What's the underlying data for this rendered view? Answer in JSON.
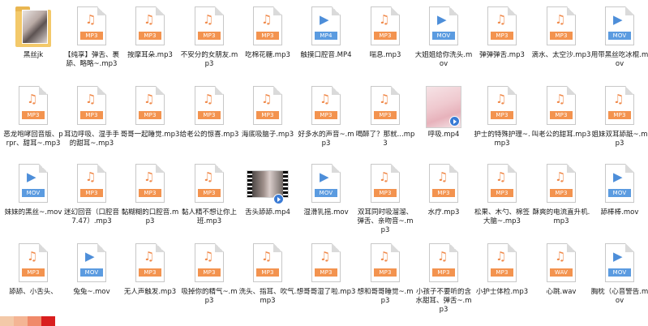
{
  "files": [
    {
      "name": "黑丝jk",
      "type": "folder",
      "icon": "folder-icon"
    },
    {
      "name": "【纯享】弹舌、裹舔、略略~.mp3",
      "type": "mp3",
      "badge": "MP3",
      "icon": "music-note-icon"
    },
    {
      "name": "按摩耳朵.mp3",
      "type": "mp3",
      "badge": "MP3",
      "icon": "music-note-icon"
    },
    {
      "name": "不安分的女朋友.mp3",
      "type": "mp3",
      "badge": "MP3",
      "icon": "music-note-icon"
    },
    {
      "name": "吃棉花糖.mp3",
      "type": "mp3",
      "badge": "MP3",
      "icon": "music-note-icon"
    },
    {
      "name": "触摸口腔音.MP4",
      "type": "mp4",
      "badge": "MP4",
      "icon": "video-camera-icon"
    },
    {
      "name": "喘息.mp3",
      "type": "mp3",
      "badge": "MP3",
      "icon": "music-note-icon"
    },
    {
      "name": "大姐姐给你洗头.mov",
      "type": "mov",
      "badge": "MOV",
      "icon": "video-camera-icon"
    },
    {
      "name": "弹弹弹舌.mp3",
      "type": "mp3",
      "badge": "MP3",
      "icon": "music-note-icon"
    },
    {
      "name": "滴水、太空沙.mp3",
      "type": "mp3",
      "badge": "MP3",
      "icon": "music-note-icon"
    },
    {
      "name": "用带黑丝吃冰棍.mov",
      "type": "mov",
      "badge": "MOV",
      "icon": "video-camera-icon"
    },
    {
      "name": "恶龙咆哮回音版、prpr、甜耳~.mp3",
      "type": "mp3",
      "badge": "MP3",
      "icon": "music-note-icon"
    },
    {
      "name": "耳边呼吸、湿手手的甜耳~.mp3",
      "type": "mp3",
      "badge": "MP3",
      "icon": "music-note-icon"
    },
    {
      "name": "哥哥一起睡觉.mp3",
      "type": "mp3",
      "badge": "MP3",
      "icon": "music-note-icon"
    },
    {
      "name": "给老公的惊喜.mp3",
      "type": "mp3",
      "badge": "MP3",
      "icon": "music-note-icon"
    },
    {
      "name": "海底吸脑子.mp3",
      "type": "mp3",
      "badge": "MP3",
      "icon": "music-note-icon"
    },
    {
      "name": "好多水的声音~.mp3",
      "type": "mp3",
      "badge": "MP3",
      "icon": "music-note-icon"
    },
    {
      "name": "喝醉了？那就...mp3",
      "type": "mp3",
      "badge": "MP3",
      "icon": "music-note-icon"
    },
    {
      "name": "呼吸.mp4",
      "type": "thumb-pink",
      "icon": "video-thumbnail-icon"
    },
    {
      "name": "护士的特殊护理~.mp3",
      "type": "mp3",
      "badge": "MP3",
      "icon": "music-note-icon"
    },
    {
      "name": "叫老公的甜耳.mp3",
      "type": "mp3",
      "badge": "MP3",
      "icon": "music-note-icon"
    },
    {
      "name": "姐妹双耳舔舐~.mp3",
      "type": "mp3",
      "badge": "MP3",
      "icon": "music-note-icon"
    },
    {
      "name": "妹妹的黑丝~.mov",
      "type": "mov",
      "badge": "MOV",
      "icon": "video-camera-icon"
    },
    {
      "name": "迷幻回音（口腔音7.47）.mp3",
      "type": "mp3",
      "badge": "MP3",
      "icon": "music-note-icon"
    },
    {
      "name": "黏糊糊的口腔音.mp3",
      "type": "mp3",
      "badge": "MP3",
      "icon": "music-note-icon"
    },
    {
      "name": "黏人精不想让你上班.mp3",
      "type": "mp3",
      "badge": "MP3",
      "icon": "music-note-icon"
    },
    {
      "name": "舌头舔舔.mp4",
      "type": "thumb-dark",
      "icon": "video-thumbnail-icon"
    },
    {
      "name": "湿滑乳摇.mov",
      "type": "mov",
      "badge": "MOV",
      "icon": "video-camera-icon"
    },
    {
      "name": "双耳同时吸溜溜、弹舌、亲吻音~.mp3",
      "type": "mp3",
      "badge": "MP3",
      "icon": "music-note-icon"
    },
    {
      "name": "水疗.mp3",
      "type": "mp3",
      "badge": "MP3",
      "icon": "music-note-icon"
    },
    {
      "name": "松果、木勺、棉签大脑~.mp3",
      "type": "mp3",
      "badge": "MP3",
      "icon": "music-note-icon"
    },
    {
      "name": "酥爽的电流直升机.mp3",
      "type": "mp3",
      "badge": "MP3",
      "icon": "music-note-icon"
    },
    {
      "name": "舔棒棒.mov",
      "type": "mov",
      "badge": "MOV",
      "icon": "video-camera-icon"
    },
    {
      "name": "舔舔、小舌头、",
      "type": "mp3",
      "badge": "MP3",
      "icon": "music-note-icon"
    },
    {
      "name": "兔兔~.mov",
      "type": "mov",
      "badge": "MOV",
      "icon": "video-camera-icon"
    },
    {
      "name": "无人声触发.mp3",
      "type": "mp3",
      "badge": "MP3",
      "icon": "music-note-icon"
    },
    {
      "name": "吸掉你的精气~.mp3",
      "type": "mp3",
      "badge": "MP3",
      "icon": "music-note-icon"
    },
    {
      "name": "洗头、指耳、吹气.mp3",
      "type": "mp3",
      "badge": "MP3",
      "icon": "music-note-icon"
    },
    {
      "name": "想哥哥湿了啦.mp3",
      "type": "mp3",
      "badge": "MP3",
      "icon": "music-note-icon"
    },
    {
      "name": "想和哥哥睡觉~.mp3",
      "type": "mp3",
      "badge": "MP3",
      "icon": "music-note-icon"
    },
    {
      "name": "小孩子不要听的含水甜耳、弹舌~.mp3",
      "type": "mp3",
      "badge": "MP3",
      "icon": "music-note-icon"
    },
    {
      "name": "小护士体检.mp3",
      "type": "mp3",
      "badge": "MP3",
      "icon": "music-note-icon"
    },
    {
      "name": "心跳.wav",
      "type": "wav",
      "badge": "WAV",
      "icon": "music-note-icon"
    },
    {
      "name": "胸枕（心音警告.mov",
      "type": "mov",
      "badge": "MOV",
      "icon": "video-camera-icon"
    }
  ],
  "colors": {
    "audio_accent": "#f3934f",
    "video_accent": "#5b9be0",
    "swatches": [
      "#f3c9a8",
      "#f4b594",
      "#f08a6a",
      "#d91e1e"
    ]
  }
}
